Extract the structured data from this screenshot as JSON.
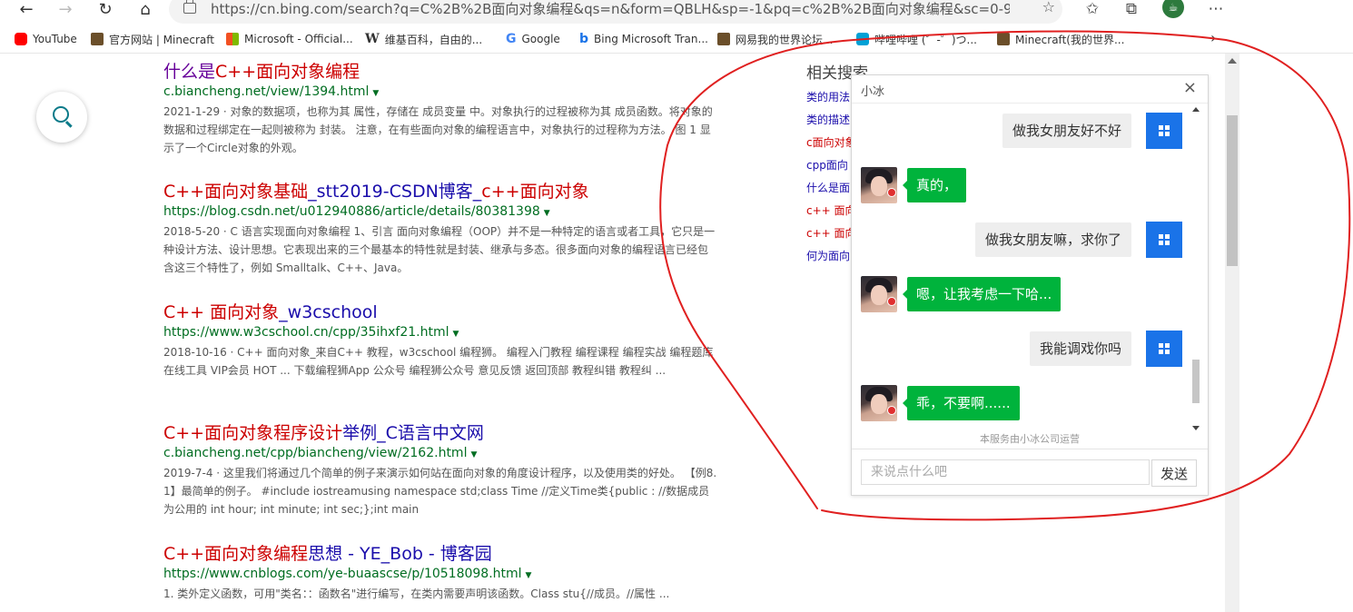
{
  "browser": {
    "url": "https://cn.bing.com/search?q=C%2B%2B面向对象编程&qs=n&form=QBLH&sp=-1&pq=c%2B%2B面向对象编程&sc=0-9&sk...",
    "nav_icons": [
      "back-icon",
      "forward-icon",
      "refresh-icon",
      "home-icon"
    ],
    "right_icons": [
      "favorites-icon",
      "collections-icon",
      "profile-avatar",
      "more-icon"
    ],
    "bookmarks": [
      {
        "label": "YouTube",
        "icon": "youtube-icon",
        "color": "#ff0000"
      },
      {
        "label": "官方网站 | Minecraft",
        "icon": "minecraft-icon",
        "color": "#6b4f2a"
      },
      {
        "label": "Microsoft - Official...",
        "icon": "microsoft-icon",
        "color": "#f25022"
      },
      {
        "label": "维基百科，自由的...",
        "icon": "wikipedia-icon",
        "color": "#000000"
      },
      {
        "label": "Google",
        "icon": "google-icon",
        "color": "#4285f4"
      },
      {
        "label": "Bing Microsoft Tran...",
        "icon": "bing-icon",
        "color": "#1a73e8"
      },
      {
        "label": "网易我的世界论坛...",
        "icon": "netease-mc-icon",
        "color": "#6b4f2a"
      },
      {
        "label": "哔哩哔哩 (゜-゜)つ...",
        "icon": "bilibili-icon",
        "color": "#00a1d6"
      },
      {
        "label": "Minecraft(我的世界...",
        "icon": "minecraft-wiki-icon",
        "color": "#6b4f2a"
      }
    ]
  },
  "results": [
    {
      "title_parts": [
        "什么是",
        "C++面向对象编程"
      ],
      "visited": true,
      "url": "c.biancheng.net/view/1394.html",
      "snippet": "2021-1-29 · 对象的数据项，也称为其 属性，存储在 成员变量 中。对象执行的过程被称为其 成员函数。将对象的数据和过程绑定在一起则被称为 封装。 注意，在有些面向对象的编程语言中，对象执行的过程称为方法。 图 1 显示了一个Circle对象的外观。"
    },
    {
      "title_parts": [
        "C++面向对象基础",
        "_stt2019-CSDN博客_",
        "c++面向对象"
      ],
      "visited": false,
      "url": "https://blog.csdn.net/u012940886/article/details/80381398",
      "snippet": "2018-5-20 · C 语言实现面向对象编程 1、引言 面向对象编程（OOP）并不是一种特定的语言或者工具，它只是一种设计方法、设计思想。它表现出来的三个最基本的特性就是封装、继承与多态。很多面向对象的编程语言已经包含这三个特性了，例如 Smalltalk、C++、Java。"
    },
    {
      "title_parts": [
        "C++ 面向对象",
        "_w3cschool"
      ],
      "visited": false,
      "url": "https://www.w3cschool.cn/cpp/35ihxf21.html",
      "snippet": "2018-10-16 · C++ 面向对象_来自C++ 教程，w3cschool 编程狮。 编程入门教程 编程课程 编程实战 编程题库 在线工具 VIP会员 HOT ... 下载编程狮App 公众号 编程狮公众号 意见反馈 返回顶部 教程纠错 教程纠 ..."
    },
    {
      "title_parts": [
        "C++面向对象程序设计",
        "举例_C语言中文网"
      ],
      "visited": false,
      "url": "c.biancheng.net/cpp/biancheng/view/2162.html",
      "snippet": "2019-7-4 · 这里我们将通过几个简单的例子来演示如何站在面向对象的角度设计程序，以及使用类的好处。 【例8.1】最简单的例子。 #include iostreamusing namespace std;class Time //定义Time类{public : //数据成员为公用的 int hour; int minute; int sec;};int main"
    },
    {
      "title_parts": [
        "C++面向对象编程",
        "思想 - YE_Bob - 博客园"
      ],
      "visited": false,
      "url": "https://www.cnblogs.com/ye-buaascse/p/10518098.html",
      "snippet": "1. 类外定义函数，可用\"类名：：函数名\"进行编写，在类内需要声明该函数。Class stu{//成员。//属性 ..."
    }
  ],
  "related": {
    "title": "相关搜索",
    "items": [
      "类的用法",
      "类的描述",
      "c面向对象",
      "cpp面向",
      "什么是面",
      "c++ 面向",
      "c++ 面向",
      "何为面向"
    ]
  },
  "chat": {
    "title": "小冰",
    "close_glyph": "×",
    "messages": [
      {
        "from": "user",
        "text": "做我女朋友好不好"
      },
      {
        "from": "bot",
        "text": "真的，"
      },
      {
        "from": "user",
        "text": "做我女朋友嘛，求你了"
      },
      {
        "from": "bot",
        "text": "嗯，让我考虑一下哈..."
      },
      {
        "from": "user",
        "text": "我能调戏你吗"
      },
      {
        "from": "bot",
        "text": "乖，不要啊......"
      }
    ],
    "footer": "本服务由小冰公司运营",
    "input_placeholder": "来说点什么吧",
    "send_label": "发送",
    "bot_bubble_color": "#00b33c",
    "user_avatar_color": "#1a73e8"
  },
  "annotation": {
    "shape": "freehand-circle",
    "color": "#e02020"
  }
}
